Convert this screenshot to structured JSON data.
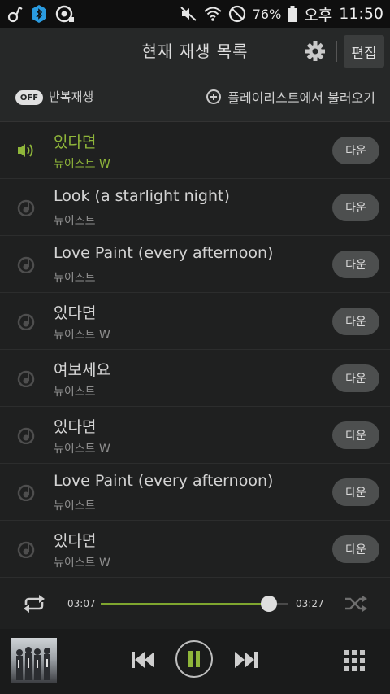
{
  "status_bar": {
    "battery": "76%",
    "ampm": "오후",
    "time": "11:50",
    "icons": [
      "music-note-icon",
      "bluetooth-icon",
      "record-icon",
      "mute-icon",
      "wifi-icon",
      "blocked-icon",
      "battery-icon"
    ]
  },
  "header": {
    "title": "현재 재생 목록",
    "edit_label": "편집",
    "icons": [
      "gear-icon"
    ]
  },
  "options": {
    "toggle_label": "OFF",
    "repeat_label": "반복재생",
    "load_label": "플레이리스트에서 불러오기"
  },
  "playlist": [
    {
      "title": "있다면",
      "artist": "뉴이스트 W",
      "playing": true,
      "button": "다운"
    },
    {
      "title": "Look (a starlight night)",
      "artist": "뉴이스트",
      "playing": false,
      "button": "다운"
    },
    {
      "title": "Love Paint (every afternoon)",
      "artist": "뉴이스트",
      "playing": false,
      "button": "다운"
    },
    {
      "title": "있다면",
      "artist": "뉴이스트 W",
      "playing": false,
      "button": "다운"
    },
    {
      "title": "여보세요",
      "artist": "뉴이스트",
      "playing": false,
      "button": "다운"
    },
    {
      "title": "있다면",
      "artist": "뉴이스트 W",
      "playing": false,
      "button": "다운"
    },
    {
      "title": "Love Paint (every afternoon)",
      "artist": "뉴이스트",
      "playing": false,
      "button": "다운"
    },
    {
      "title": "있다면",
      "artist": "뉴이스트 W",
      "playing": false,
      "button": "다운"
    }
  ],
  "progress": {
    "current": "03:07",
    "total": "03:27",
    "fraction": 0.9
  },
  "player": {
    "icons": [
      "album-art",
      "previous-icon",
      "pause-icon",
      "next-icon",
      "grid-menu-icon",
      "repeat-icon",
      "shuffle-icon"
    ]
  },
  "colors": {
    "accent": "#8fb63a",
    "background": "#1e1f1f"
  }
}
